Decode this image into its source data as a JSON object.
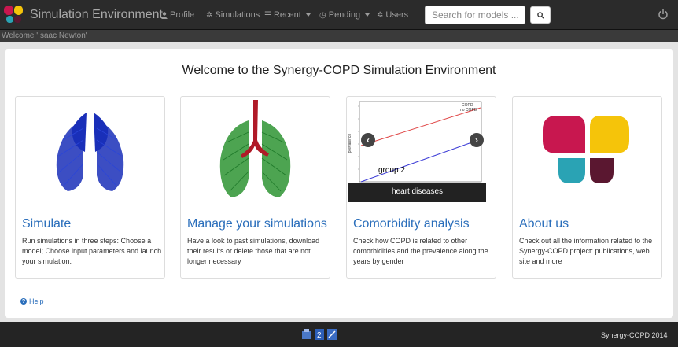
{
  "navbar": {
    "title": "Simulation Environment",
    "items": [
      {
        "label": "Profile",
        "icon": "user-icon"
      },
      {
        "label": "Simulations",
        "icon": "gear-icon"
      },
      {
        "label": "Recent",
        "icon": "list-icon",
        "dropdown": true
      },
      {
        "label": "Pending",
        "icon": "clock-icon",
        "dropdown": true
      },
      {
        "label": "Users",
        "icon": "gear-icon"
      }
    ],
    "search_placeholder": "Search for models ..."
  },
  "welcome": "Welcome 'Isaac Newton'",
  "page_title": "Welcome to the Synergy-COPD Simulation Environment",
  "cards": [
    {
      "title": "Simulate",
      "text": "Run simulations in three steps: Choose a model; Choose input parameters and launch your simulation."
    },
    {
      "title": "Manage your simulations",
      "text": "Have a look to past simulations, download their results or delete those that are not longer necessary"
    },
    {
      "title": "Comorbidity analysis",
      "text": "Check how COPD is related to other comorbidities and the prevalence along the years by gender",
      "carousel_caption": "heart diseases",
      "chart_label": "group 2",
      "legend": [
        "COPD",
        "no COPD"
      ],
      "ylabel": "prevalence"
    },
    {
      "title": "About us",
      "text": "Check out all the information related to the Synergy-COPD project: publications, web site and more"
    }
  ],
  "help": "Help",
  "footer": {
    "copyright": "Synergy-COPD 2014"
  },
  "colors": {
    "link": "#2a6ebb",
    "navbar": "#2b2b2b",
    "logo_red": "#c8174f",
    "logo_yellow": "#f5c40a",
    "logo_teal": "#2aa3b4",
    "logo_maroon": "#5a1730"
  }
}
